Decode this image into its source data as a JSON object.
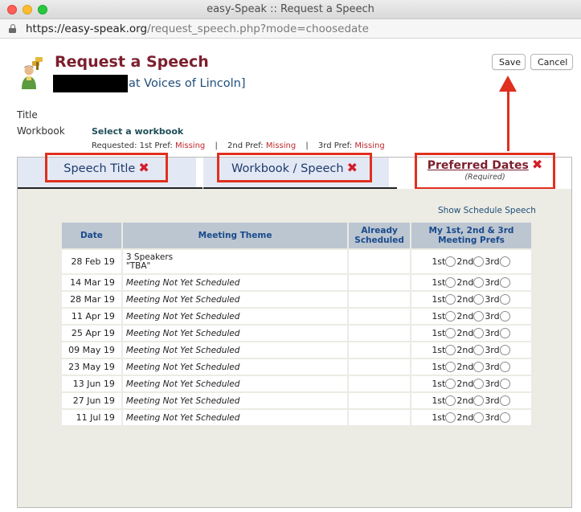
{
  "window": {
    "title": "easy-Speak :: Request a Speech"
  },
  "address": {
    "host": "https://easy-speak.org",
    "path": "/request_speech.php?mode=choosedate"
  },
  "header": {
    "title": "Request a Speech",
    "club": "at Voices of Lincoln]",
    "save_label": "Save",
    "cancel_label": "Cancel"
  },
  "form": {
    "title_label": "Title",
    "workbook_label": "Workbook",
    "workbook_link": "Select a workbook",
    "requested_label": "Requested: 1st Pref:",
    "pref1_value": "Missing",
    "pref2_label": "2nd Pref:",
    "pref2_value": "Missing",
    "pref3_label": "3rd Pref:",
    "pref3_value": "Missing",
    "separator": "|"
  },
  "tabs": {
    "speech_title": "Speech Title",
    "workbook_speech": "Workbook / Speech",
    "preferred_dates": "Preferred Dates",
    "preferred_dates_note": "(Required)",
    "x_glyph": "✖"
  },
  "schedule": {
    "show_link": "Show Schedule Speech",
    "headers": {
      "date": "Date",
      "theme": "Meeting Theme",
      "already": "Already Scheduled",
      "prefs": "My 1st, 2nd & 3rd Meeting Prefs"
    },
    "pref_labels": [
      "1st",
      "2nd",
      "3rd"
    ],
    "rows": [
      {
        "date": "28 Feb 19",
        "theme_line1": "3 Speakers",
        "theme_line2": "\"TBA\"",
        "already": ""
      },
      {
        "date": "14 Mar 19",
        "theme": "Meeting Not Yet Scheduled",
        "already": ""
      },
      {
        "date": "28 Mar 19",
        "theme": "Meeting Not Yet Scheduled",
        "already": ""
      },
      {
        "date": "11 Apr 19",
        "theme": "Meeting Not Yet Scheduled",
        "already": ""
      },
      {
        "date": "25 Apr 19",
        "theme": "Meeting Not Yet Scheduled",
        "already": ""
      },
      {
        "date": "09 May 19",
        "theme": "Meeting Not Yet Scheduled",
        "already": ""
      },
      {
        "date": "23 May 19",
        "theme": "Meeting Not Yet Scheduled",
        "already": ""
      },
      {
        "date": "13 Jun 19",
        "theme": "Meeting Not Yet Scheduled",
        "already": ""
      },
      {
        "date": "27 Jun 19",
        "theme": "Meeting Not Yet Scheduled",
        "already": ""
      },
      {
        "date": "11 Jul 19",
        "theme": "Meeting Not Yet Scheduled",
        "already": ""
      }
    ]
  },
  "colors": {
    "title": "#7b1f2e",
    "link": "#1f4e79",
    "missing": "#c0282d",
    "highlight": "#e0301f",
    "header_bg": "#bcc6d1",
    "panel_bg": "#ecebe4"
  }
}
